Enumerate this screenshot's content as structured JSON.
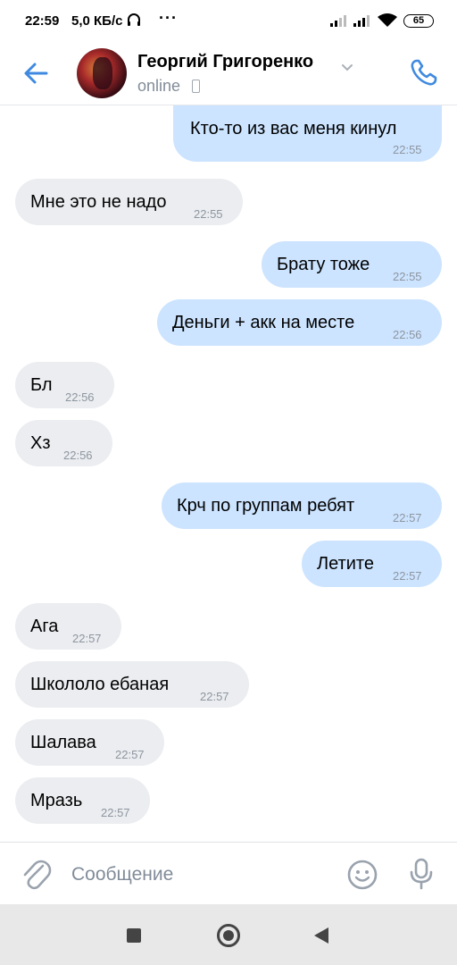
{
  "status_bar": {
    "time": "22:59",
    "speed": "5,0 КБ/с",
    "more": "···",
    "battery": "65"
  },
  "header": {
    "name": "Георгий Григоренко",
    "status": "online",
    "accent": "#2a5885"
  },
  "messages": [
    {
      "dir": "out",
      "text": "Кто-то из вас меня кинул",
      "time": "22:55"
    },
    {
      "dir": "in",
      "text": "Мне это не надо",
      "time": "22:55"
    },
    {
      "dir": "out",
      "text": "Брату тоже",
      "time": "22:55"
    },
    {
      "dir": "out",
      "text": "Деньги + акк на месте",
      "time": "22:56"
    },
    {
      "dir": "in",
      "text": "Бл",
      "time": "22:56"
    },
    {
      "dir": "in",
      "text": "Хз",
      "time": "22:56"
    },
    {
      "dir": "out",
      "text": "Крч по группам ребят",
      "time": "22:57"
    },
    {
      "dir": "out",
      "text": "Летите",
      "time": "22:57"
    },
    {
      "dir": "in",
      "text": "Ага",
      "time": "22:57"
    },
    {
      "dir": "in",
      "text": "Школоло ебаная",
      "time": "22:57"
    },
    {
      "dir": "in",
      "text": "Шалава",
      "time": "22:57"
    },
    {
      "dir": "in",
      "text": "Мразь",
      "time": "22:57"
    }
  ],
  "composer": {
    "placeholder": "Сообщение"
  },
  "icons": {
    "back": "arrow-left-icon",
    "call": "phone-icon",
    "attach": "paperclip-icon",
    "emoji": "smiley-icon",
    "mic": "microphone-icon"
  }
}
